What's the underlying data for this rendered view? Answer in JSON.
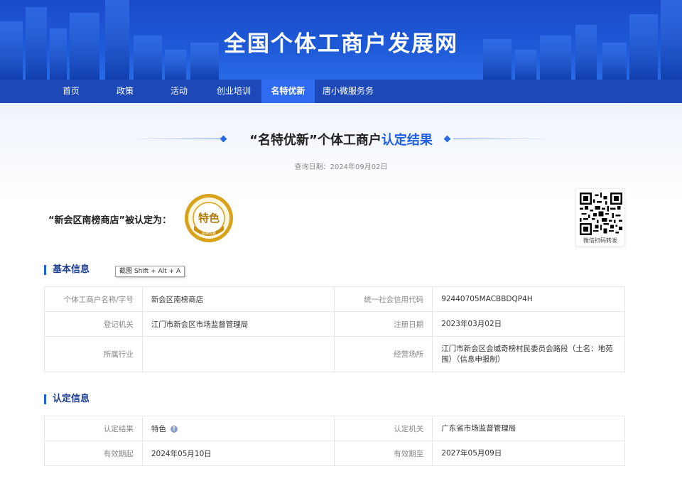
{
  "site": {
    "title": "全国个体工商户发展网"
  },
  "nav": {
    "items": [
      {
        "label": "首页"
      },
      {
        "label": "政策"
      },
      {
        "label": "活动"
      },
      {
        "label": "创业培训"
      },
      {
        "label": "名特优新"
      },
      {
        "label": "唐小微服务务"
      }
    ],
    "active_index": 4
  },
  "result": {
    "heading_prefix": "“名特优新”个体工商户",
    "heading_highlight": "认定结果",
    "query_date": "查询日期：2024年09月02日",
    "store_statement": "“新会区南榜商店”被认定为：",
    "badge_text": "特色",
    "badge_bottom_text": "名特优新",
    "qr_caption": "微信扫码转发"
  },
  "basic_info": {
    "title": "基本信息",
    "rows": [
      {
        "label1": "个体工商户名称/字号",
        "value1": "新会区南榜商店",
        "label2": "统一社会信用代码",
        "value2": "92440705MACBBDQP4H"
      },
      {
        "label1": "登记机关",
        "value1": "江门市新会区市场监督管理局",
        "label2": "注册日期",
        "value2": "2023年03月02日"
      },
      {
        "label1": "所属行业",
        "value1": "",
        "label2": "经营场所",
        "value2": "江门市新会区会城奇榜村民委员会路段（土名：地苑围）（信息申报制）"
      }
    ]
  },
  "cert_info": {
    "title": "认定信息",
    "rows": [
      {
        "label1": "认定结果",
        "value1": "特色",
        "label2": "认定机关",
        "value2": "广东省市场监督管理局"
      },
      {
        "label1": "有效期起",
        "value1": "2024年05月10日",
        "label2": "有效期至",
        "value2": "2027年05月09日"
      }
    ]
  },
  "tooltip": {
    "text": "截图 Shift + Alt + A"
  },
  "colors": {
    "brand_blue": "#1f5fe0",
    "nav_bg": "#1d49b8",
    "badge_gold": "#d9a21b"
  }
}
